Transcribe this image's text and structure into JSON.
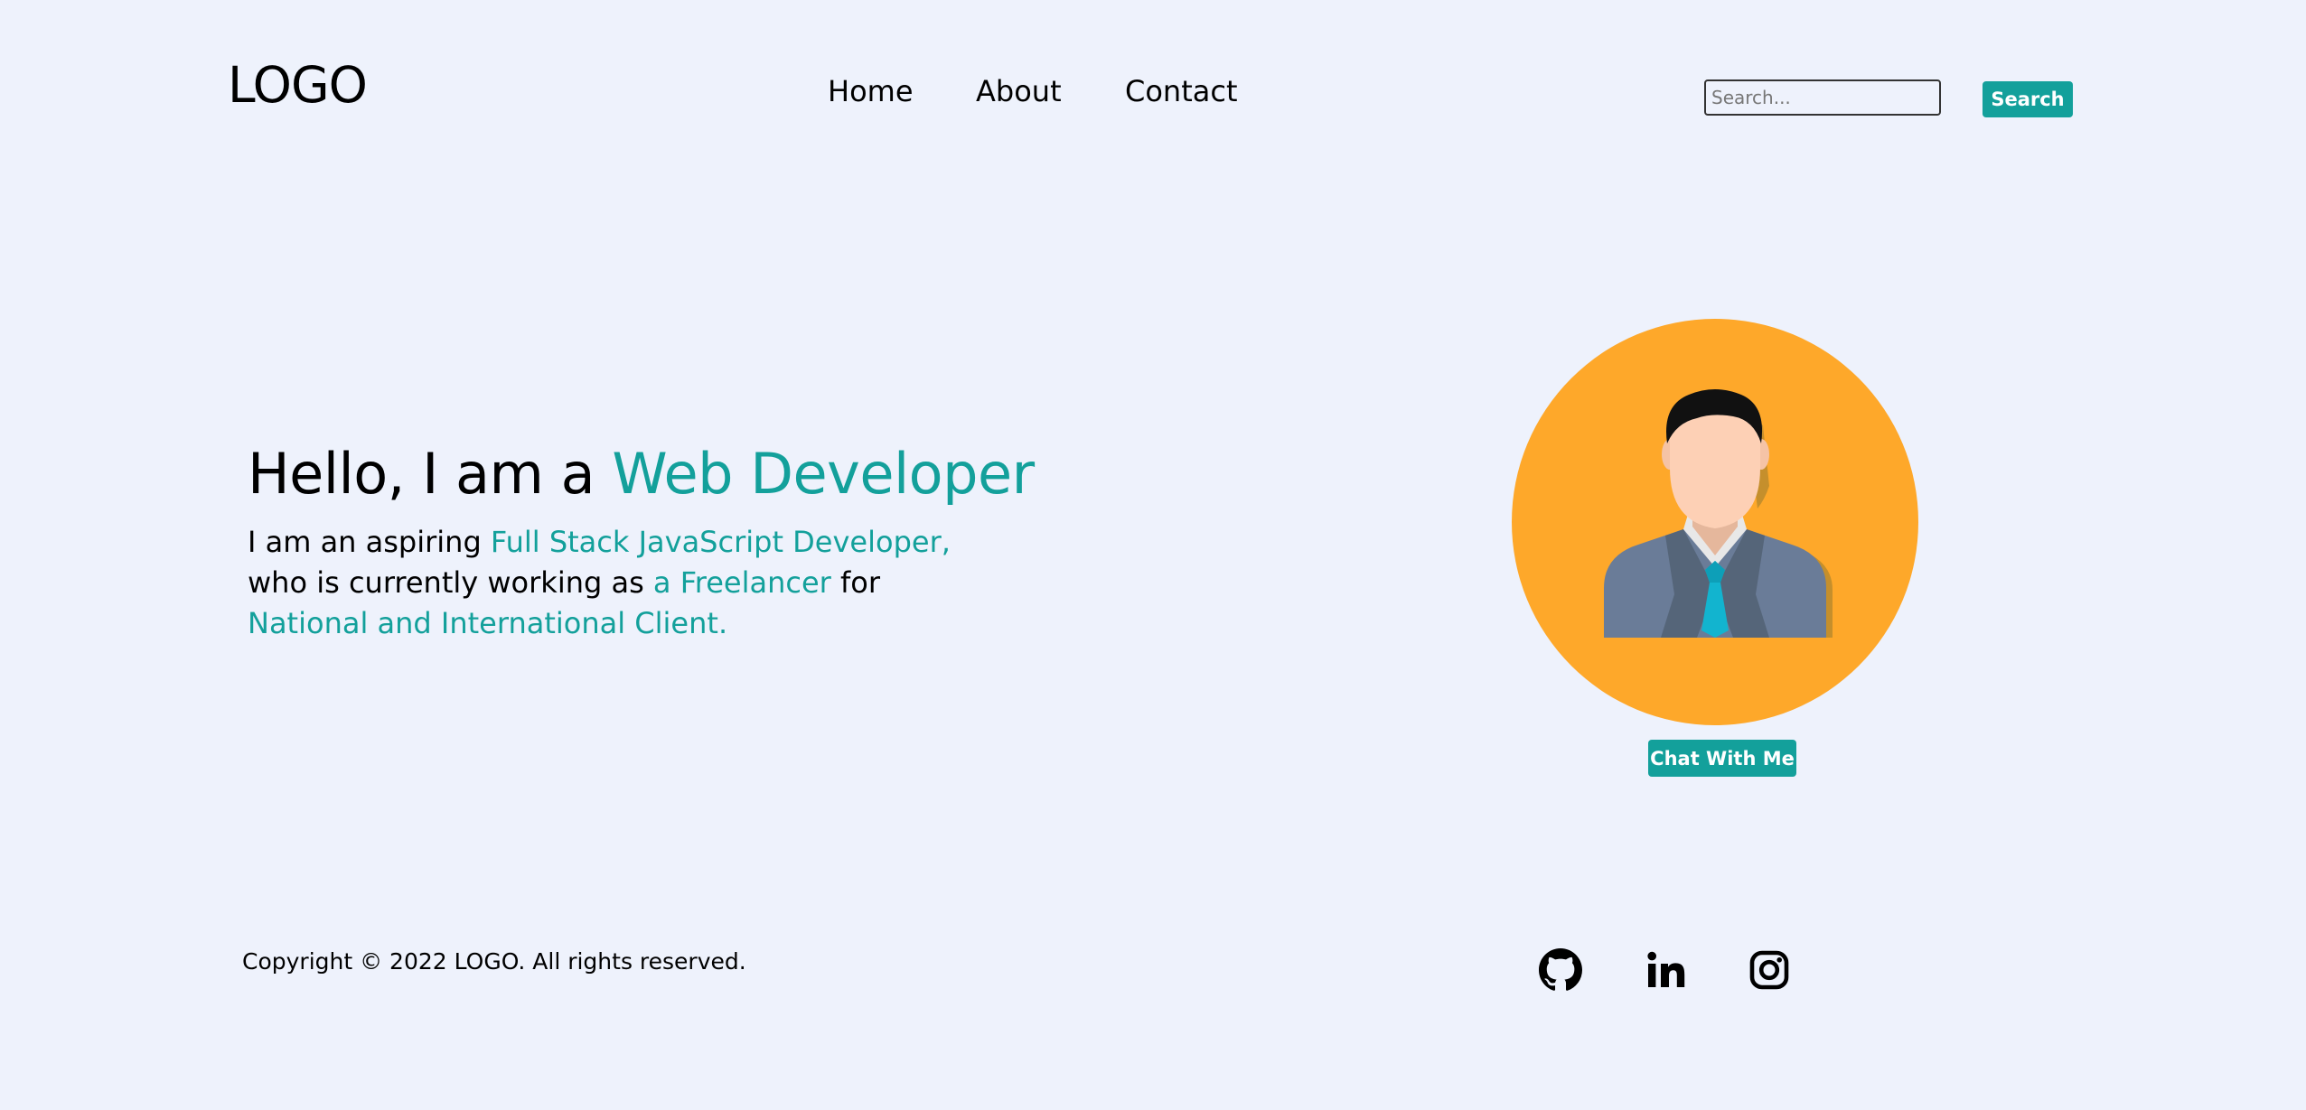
{
  "header": {
    "logo": "LOGO",
    "nav": [
      {
        "label": "Home"
      },
      {
        "label": "About"
      },
      {
        "label": "Contact"
      }
    ],
    "search": {
      "placeholder": "Search...",
      "button_label": "Search"
    }
  },
  "hero": {
    "title_prefix": "Hello, I am a ",
    "title_accent": "Web Developer",
    "desc_line1_prefix": "I am an aspiring ",
    "desc_line1_accent": "Full Stack JavaScript Developer,",
    "desc_line2_prefix": "who is currently working as ",
    "desc_line2_accent": "a Freelancer",
    "desc_line2_suffix": " for",
    "desc_line3_accent": "National and International Client.",
    "chat_button": "Chat With Me",
    "avatar_icon": "businessman-avatar-icon"
  },
  "footer": {
    "copyright": "Copyright © 2022 LOGO. All rights reserved.",
    "social": [
      {
        "icon": "github-icon"
      },
      {
        "icon": "linkedin-icon"
      },
      {
        "icon": "instagram-icon"
      }
    ]
  },
  "colors": {
    "background": "#eef2fc",
    "accent": "#13a09b",
    "avatar_bg": "#fea82a"
  }
}
